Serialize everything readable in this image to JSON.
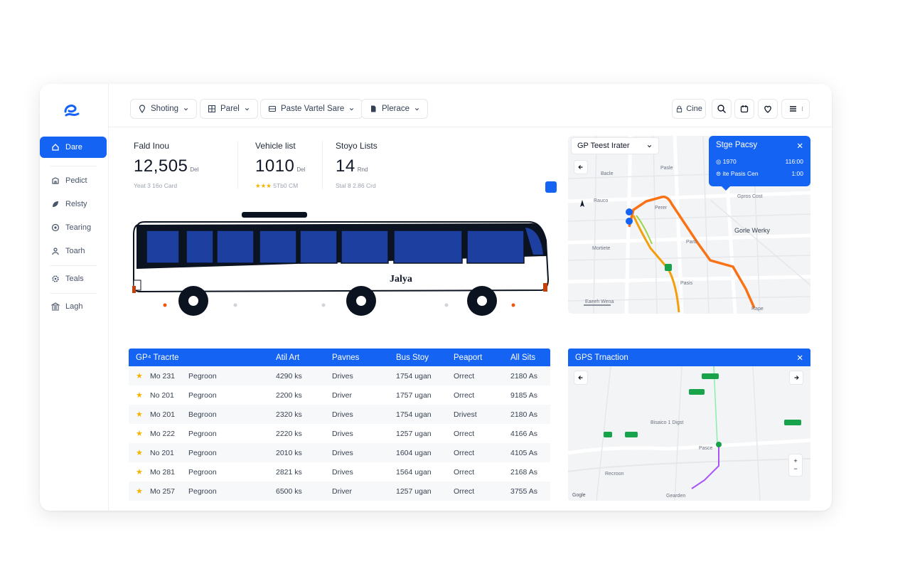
{
  "sidebar": {
    "items": [
      {
        "label": "Dare"
      },
      {
        "label": "Pedict"
      },
      {
        "label": "Relsty"
      },
      {
        "label": "Tearing"
      },
      {
        "label": "Toarh"
      },
      {
        "label": "Teals"
      },
      {
        "label": "Lagh"
      }
    ]
  },
  "toolbar": {
    "filters": [
      {
        "label": "Shoting"
      },
      {
        "label": "Parel"
      },
      {
        "label": "Paste Vartel Sare"
      },
      {
        "label": "Plerace"
      }
    ],
    "cine_label": "Cine"
  },
  "stats": [
    {
      "label": "Fald Inou",
      "value": "12,505",
      "unit": "Del",
      "sub": "Yeat 3 16o Card"
    },
    {
      "label": "Vehicle list",
      "value": "1010",
      "unit": "Del",
      "stars": "★★★",
      "sub": "5Tb0 CM"
    },
    {
      "label": "Stoyo Lists",
      "value": "14",
      "unit": "Rnd",
      "sub": "Stal 8 2.86 Crd"
    }
  ],
  "bus": {
    "name": "Jalya"
  },
  "map_top": {
    "dropdown": "GP Teest Irater",
    "card": {
      "title": "Stge Pacsy",
      "row1_left": "1970",
      "row1_right": "116:00",
      "row2_left": "ite Pasis Cen",
      "row2_right": "1:00"
    },
    "labels": {
      "l1": "Pasle",
      "l2": "Bacle",
      "l3": "Rauco",
      "l4": "Perer",
      "l5": "Gpros Cost",
      "l6": "Gorle Werky",
      "l7": "Mortiete",
      "l8": "Pard",
      "l9": "Pasis",
      "l10": "Rape",
      "l11": "Eaeeh Wena"
    }
  },
  "table": {
    "headers": [
      "GP⁴ Tracrte",
      "Atil Art",
      "Pavnes",
      "Bus Stoy",
      "Peaport",
      "All Sits"
    ],
    "rows": [
      [
        "Mo 231",
        "Pegroon",
        "4290 ks",
        "Drives",
        "1754 ugan",
        "Orrect",
        "2180 As"
      ],
      [
        "No 201",
        "Pegroon",
        "2200 ks",
        "Driver",
        "1757 ugan",
        "Orrect",
        "9185 As"
      ],
      [
        "Mo 201",
        "Begroon",
        "2320 ks",
        "Drives",
        "1754 ugan",
        "Drivest",
        "2180 As"
      ],
      [
        "Mo 222",
        "Pegroon",
        "2220 ks",
        "Drives",
        "1257 ugan",
        "Orrect",
        "4166 As"
      ],
      [
        "No 201",
        "Pegroon",
        "2010 ks",
        "Drives",
        "1604 ugan",
        "Orrect",
        "4105 As"
      ],
      [
        "Mo 281",
        "Pegroon",
        "2821 ks",
        "Drives",
        "1564 ugan",
        "Orrect",
        "2168 As"
      ],
      [
        "Mo 257",
        "Pegroon",
        "6500 ks",
        "Driver",
        "1257 ugan",
        "Orrect",
        "3755 As"
      ]
    ]
  },
  "map_bottom": {
    "title": "GPS Trnaction",
    "labels": {
      "a": "Bisaico 1 Digst",
      "b": "Recroon",
      "c": "Gearden",
      "d": "Pasce",
      "e": "Gogle"
    }
  },
  "colors": {
    "accent": "#1463f3",
    "route": "#f97316",
    "star": "#f5b301"
  }
}
